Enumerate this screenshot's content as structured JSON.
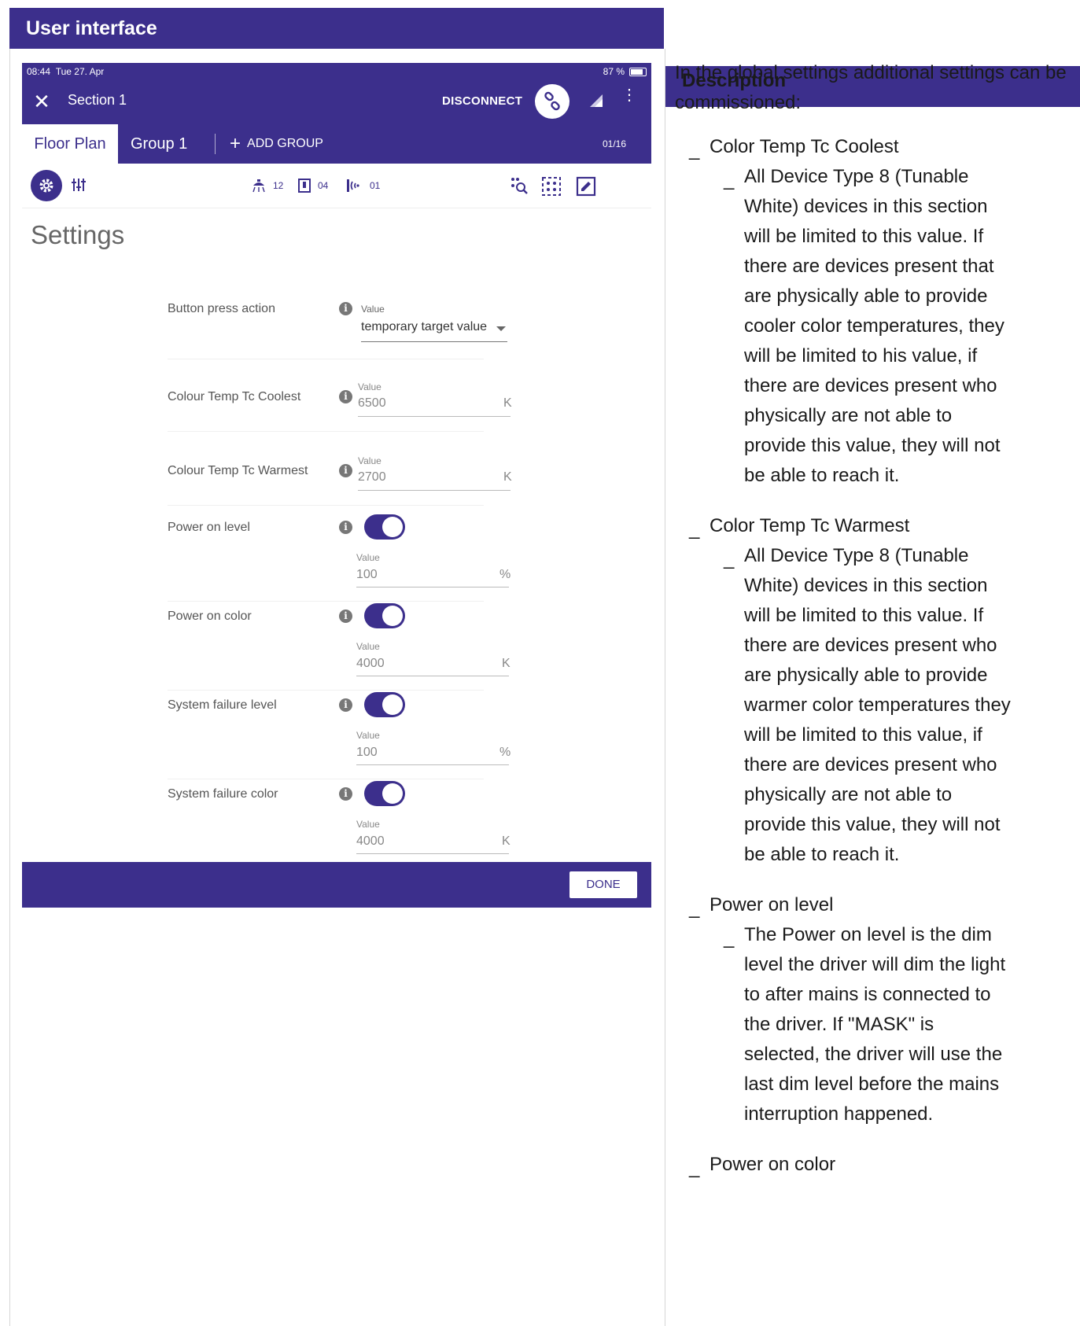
{
  "table": {
    "ui_header": "User interface",
    "desc_header": "Description"
  },
  "status": {
    "time": "08:44",
    "date": "Tue 27. Apr",
    "battery": "87 %"
  },
  "appbar": {
    "title": "Section 1",
    "disconnect": "DISCONNECT"
  },
  "tabs": {
    "floor_plan": "Floor Plan",
    "group": "Group 1",
    "add_group": "ADD GROUP",
    "pager": "01/16"
  },
  "toolbar": {
    "luminaires": "12",
    "switches": "04",
    "sensors": "01"
  },
  "settings": {
    "title": "Settings",
    "value_label": "Value",
    "rows": [
      {
        "label": "Button press action",
        "value": "temporary target value",
        "unit": ""
      },
      {
        "label": "Colour Temp Tc Coolest",
        "value": "6500",
        "unit": "K"
      },
      {
        "label": "Colour Temp Tc Warmest",
        "value": "2700",
        "unit": "K"
      },
      {
        "label": "Power on level",
        "value": "100",
        "unit": "%",
        "enabled": true
      },
      {
        "label": "Power on color",
        "value": "4000",
        "unit": "K",
        "enabled": true
      },
      {
        "label": "System failure level",
        "value": "100",
        "unit": "%",
        "enabled": true
      },
      {
        "label": "System failure color",
        "value": "4000",
        "unit": "K",
        "enabled": true
      }
    ],
    "done": "DONE"
  },
  "description": {
    "intro": "In the global settings additional settings can be commissioned:",
    "dash": "_",
    "items": [
      {
        "title": "Color Temp Tc Coolest",
        "text": "All Device Type 8 (Tunable White) devices in this section will be limited to this value. If there are devices present that are physically able to provide cooler color temperatures, they will be limited to his value, if there are devices present who physically are not able to provide this value, they will not be able to reach it."
      },
      {
        "title": "Color Temp Tc Warmest",
        "text": "All Device Type 8 (Tunable White) devices in this section will be limited to this value. If there are devices present who are physically able to provide warmer color temperatures they will be limited to this value, if there are devices present who physically are not able to provide this value, they will not be able to reach it."
      },
      {
        "title": "Power on level",
        "text": "The Power on level is the dim level the driver will dim the light to after mains is connected to the driver. If \"MASK\" is selected, the driver will use the last dim level before the mains interruption happened."
      },
      {
        "title": "Power on color"
      }
    ]
  },
  "colors": {
    "brand": "#3c2f8c",
    "label_text": "#555555",
    "muted": "#888888"
  }
}
